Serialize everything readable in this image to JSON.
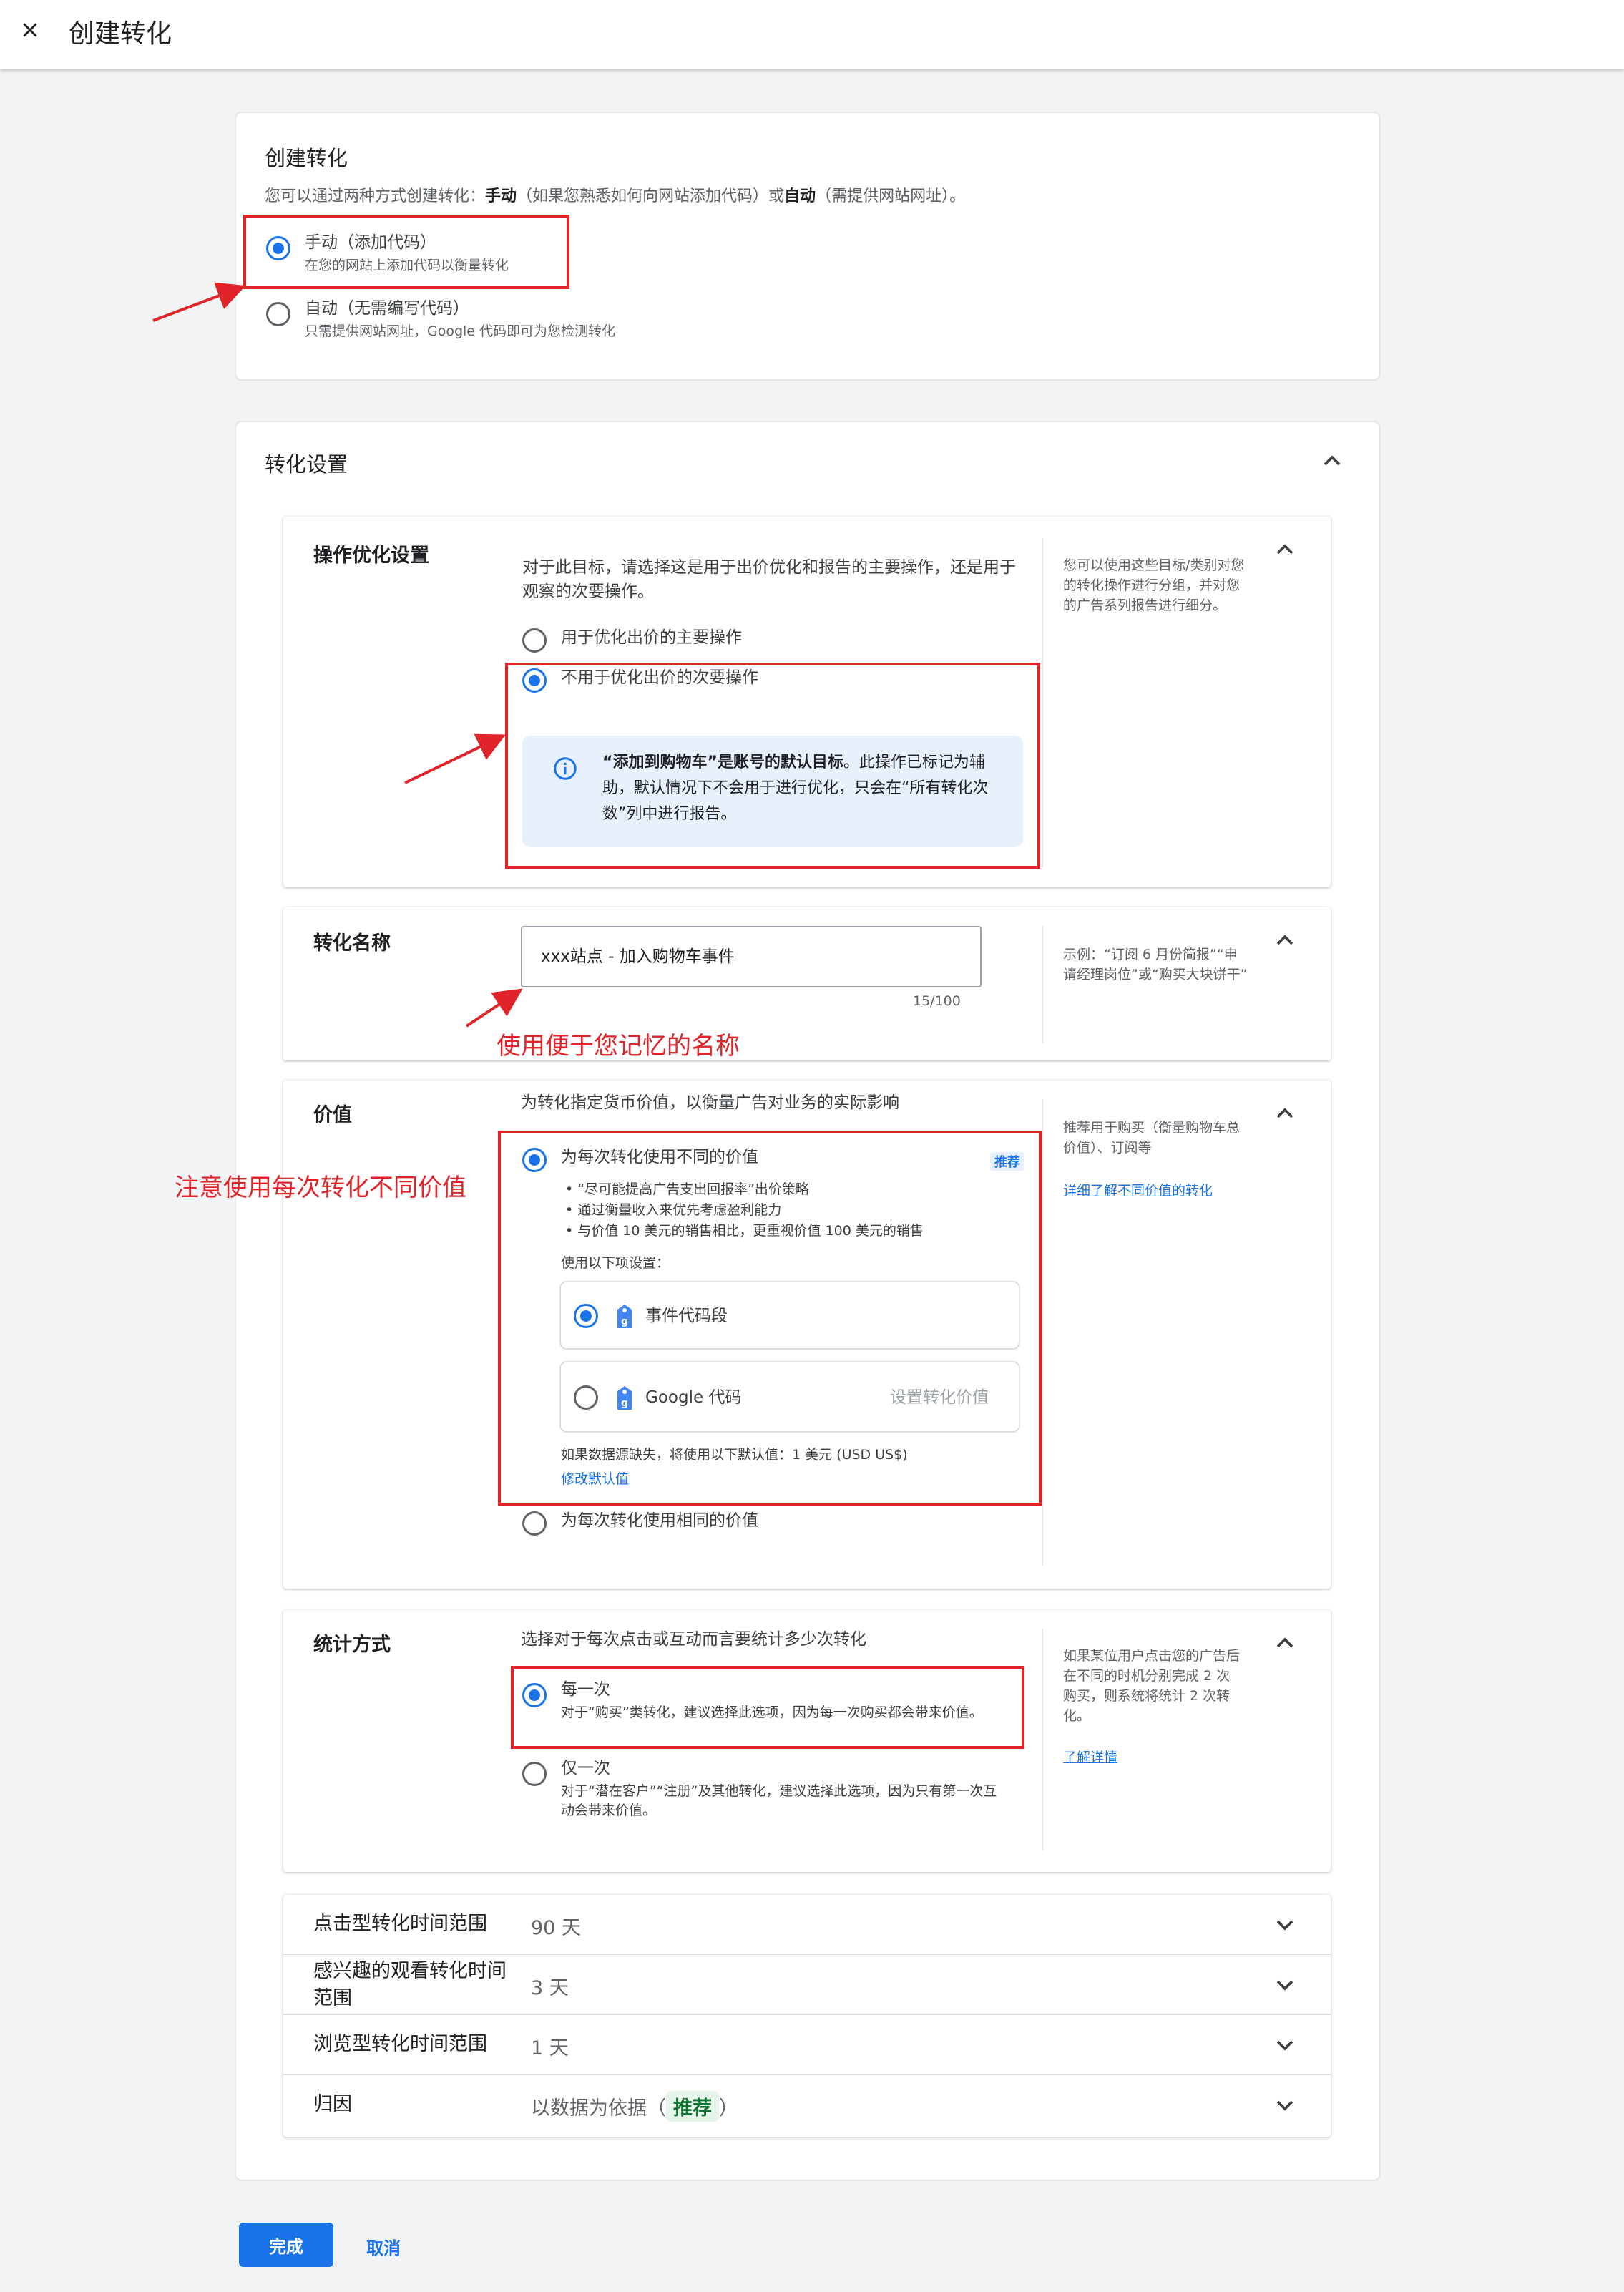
{
  "header": {
    "title": "创建转化"
  },
  "create": {
    "title": "创建转化",
    "desc_pre": "您可以通过两种方式创建转化：",
    "desc_manual": "手动",
    "desc_mid": "（如果您熟悉如何向网站添加代码）或",
    "desc_auto": "自动",
    "desc_post": "（需提供网站网址）。",
    "options": [
      {
        "title": "手动（添加代码）",
        "sub": "在您的网站上添加代码以衡量转化",
        "selected": true
      },
      {
        "title": "自动（无需编写代码）",
        "sub": "只需提供网站网址，Google 代码即可为您检测转化",
        "selected": false
      }
    ]
  },
  "settings": {
    "title": "转化设置",
    "action_opt": {
      "label": "操作优化设置",
      "desc": "对于此目标，请选择这是用于出价优化和报告的主要操作，还是用于观察的次要操作。",
      "options": [
        "用于优化出价的主要操作",
        "不用于优化出价的次要操作"
      ],
      "info_bold": "“添加到购物车”是账号的默认目标",
      "info_text": "。此操作已标记为辅助，默认情况下不会用于进行优化，只会在“所有转化次数”列中进行报告。",
      "side": "您可以使用这些目标/类别对您的转化操作进行分组，并对您的广告系列报告进行细分。"
    },
    "name": {
      "label": "转化名称",
      "value": "xxx站点 - 加入购物车事件",
      "counter": "15/100",
      "side": "示例：“订阅 6 月份简报”“申请经理岗位”或“购买大块饼干”"
    },
    "value": {
      "label": "价值",
      "desc": "为转化指定货币价值，以衡量广告对业务的实际影响",
      "opt1_title": "为每次转化使用不同的价值",
      "recommend": "推荐",
      "bullets": [
        "“尽可能提高广告支出回报率”出价策略",
        "通过衡量收入来优先考虑盈利能力",
        "与价值 10 美元的销售相比，更重视价值 100 美元的销售"
      ],
      "use_following": "使用以下项设置：",
      "sources": [
        {
          "name": "事件代码段",
          "action": ""
        },
        {
          "name": "Google 代码",
          "action": "设置转化价值"
        }
      ],
      "default_note": "如果数据源缺失，将使用以下默认值：1 美元 (USD US$)",
      "modify_default": "修改默认值",
      "opt2_title": "为每次转化使用相同的价值",
      "side": "推荐用于购买（衡量购物车总价值）、订阅等",
      "side_link": "详细了解不同价值的转化"
    },
    "count": {
      "label": "统计方式",
      "desc": "选择对于每次点击或互动而言要统计多少次转化",
      "every_title": "每一次",
      "every_sub": "对于“购买”类转化，建议选择此选项，因为每一次购买都会带来价值。",
      "once_title": "仅一次",
      "once_sub": "对于“潜在客户”“注册”及其他转化，建议选择此选项，因为只有第一次互动会带来价值。",
      "side": "如果某位用户点击您的广告后在不同的时机分别完成 2 次购买，则系统将统计 2 次转化。",
      "side_link": "了解详情"
    },
    "rows": [
      {
        "label": "点击型转化时间范围",
        "value": "90 天"
      },
      {
        "label": "感兴趣的观看转化时间范围",
        "value": "3 天"
      },
      {
        "label": "浏览型转化时间范围",
        "value": "1 天"
      },
      {
        "label": "归因",
        "value_pre": "以数据为依据（",
        "badge": "推荐",
        "value_post": "）"
      }
    ]
  },
  "annotations": {
    "name_tip": "使用便于您记忆的名称",
    "value_tip": "注意使用每次转化不同价值"
  },
  "footer": {
    "done": "完成",
    "cancel": "取消"
  }
}
